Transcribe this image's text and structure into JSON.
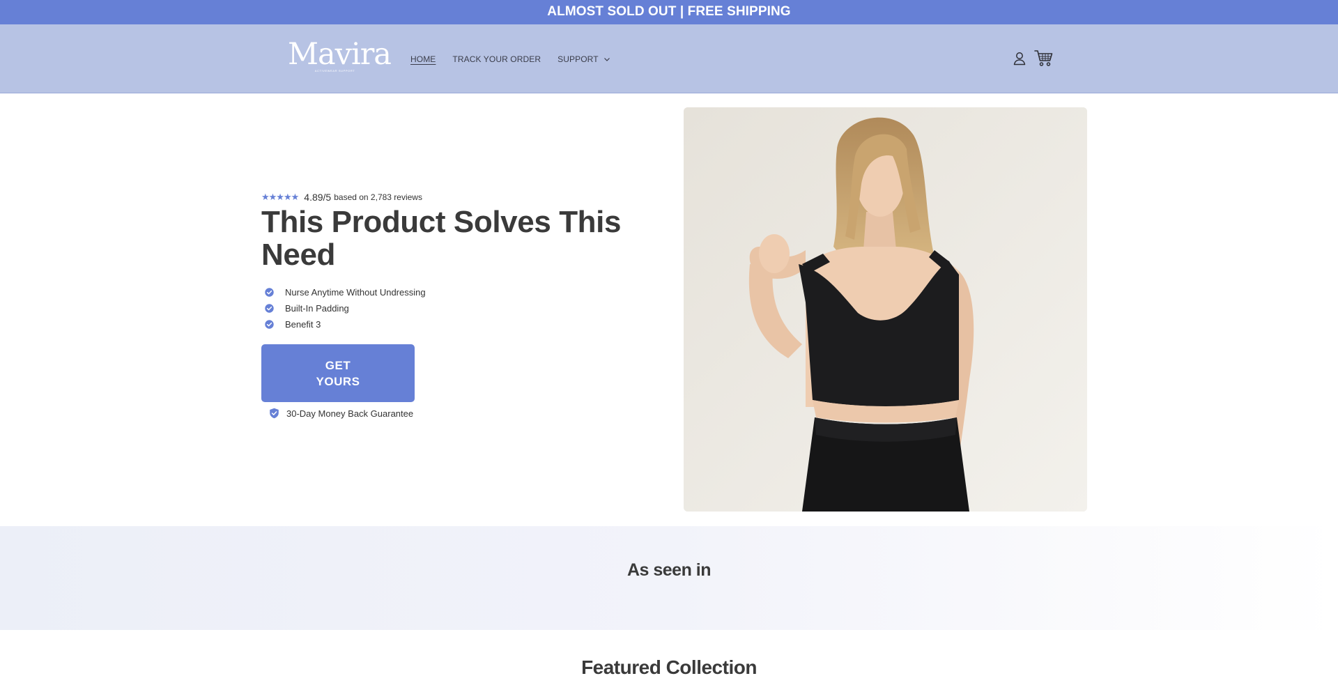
{
  "announcement": {
    "text": "ALMOST SOLD OUT | FREE SHIPPING"
  },
  "header": {
    "logo": {
      "name": "Mavira",
      "tagline": "ACTIVEWEAR SUPPORT"
    },
    "nav": [
      {
        "label": "HOME",
        "active": true
      },
      {
        "label": "TRACK YOUR ORDER",
        "active": false
      },
      {
        "label": "SUPPORT",
        "has_dropdown": true
      }
    ],
    "icons": [
      "account-icon",
      "cart-icon"
    ]
  },
  "hero": {
    "rating": {
      "stars": "★★★★★",
      "score": "4.89/5",
      "text": "based on 2,783 reviews"
    },
    "headline": "This Product Solves This Need",
    "benefits": [
      "Nurse Anytime Without Undressing",
      "Built-In Padding",
      "Benefit 3"
    ],
    "cta_label": "GET YOURS",
    "guarantee": "30-Day Money Back Guarantee",
    "image": "woman-in-black-sports-bra-and-leggings"
  },
  "seen_in": {
    "title": "As seen in"
  },
  "featured": {
    "title": "Featured Collection"
  },
  "colors": {
    "accent": "#6680d6",
    "header_bg": "#b7c3e4",
    "text": "#3a3a3a"
  }
}
